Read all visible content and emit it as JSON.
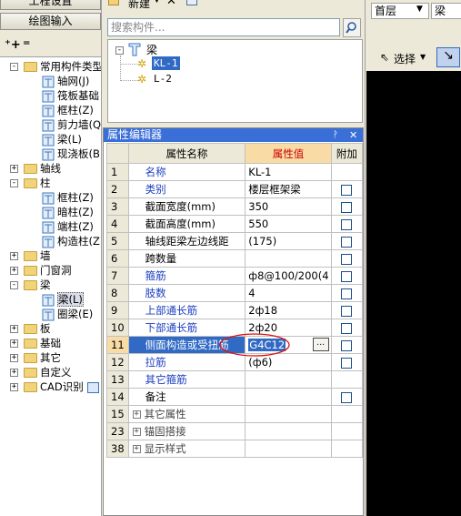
{
  "left_panel": {
    "tab_top": "工程设置",
    "tab_draw": "绘图输入",
    "tree": [
      {
        "label": "常用构件类型",
        "level": 0,
        "state": "-",
        "folder": true
      },
      {
        "label": "轴网(J)",
        "level": 1,
        "icon": "grid-icon"
      },
      {
        "label": "筏板基础",
        "level": 1,
        "icon": "raft-icon"
      },
      {
        "label": "框柱(Z)",
        "level": 1,
        "icon": "column-icon"
      },
      {
        "label": "剪力墙(Q)",
        "level": 1,
        "icon": "wall-icon"
      },
      {
        "label": "梁(L)",
        "level": 1,
        "icon": "beam-icon"
      },
      {
        "label": "现浇板(B)",
        "level": 1,
        "icon": "slab-icon"
      },
      {
        "label": "轴线",
        "level": 0,
        "state": "+",
        "folder": true
      },
      {
        "label": "柱",
        "level": 0,
        "state": "-",
        "folder": true
      },
      {
        "label": "框柱(Z)",
        "level": 1,
        "icon": "column-icon"
      },
      {
        "label": "暗柱(Z)",
        "level": 1,
        "icon": "column-icon"
      },
      {
        "label": "端柱(Z)",
        "level": 1,
        "icon": "column-icon"
      },
      {
        "label": "构造柱(Z)",
        "level": 1,
        "icon": "constr-column-icon"
      },
      {
        "label": "墙",
        "level": 0,
        "state": "+",
        "folder": true
      },
      {
        "label": "门窗洞",
        "level": 0,
        "state": "+",
        "folder": true
      },
      {
        "label": "梁",
        "level": 0,
        "state": "-",
        "folder": true
      },
      {
        "label": "梁(L)",
        "level": 1,
        "icon": "beam-icon",
        "selected": true
      },
      {
        "label": "圈梁(E)",
        "level": 1,
        "icon": "ring-beam-icon"
      },
      {
        "label": "板",
        "level": 0,
        "state": "+",
        "folder": true
      },
      {
        "label": "基础",
        "level": 0,
        "state": "+",
        "folder": true
      },
      {
        "label": "其它",
        "level": 0,
        "state": "+",
        "folder": true
      },
      {
        "label": "自定义",
        "level": 0,
        "state": "+",
        "folder": true
      },
      {
        "label": "CAD识别",
        "level": 0,
        "state": "+",
        "folder": true
      }
    ]
  },
  "toolbar": {
    "new_label": "新建"
  },
  "search": {
    "placeholder": "搜索构件..."
  },
  "component_tree": {
    "root": "梁",
    "items": [
      {
        "label": "KL-1",
        "selected": true
      },
      {
        "label": "L-2",
        "selected": false
      }
    ]
  },
  "property_editor": {
    "title": "属性编辑器",
    "headers": {
      "name": "属性名称",
      "value": "属性值",
      "extra": "附加"
    },
    "rows": [
      {
        "num": "1",
        "name": "名称",
        "value": "KL-1",
        "checkbox": false,
        "style": "k"
      },
      {
        "num": "2",
        "name": "类别",
        "value": "楼层框架梁",
        "checkbox": true,
        "style": "k"
      },
      {
        "num": "3",
        "name": "截面宽度(mm)",
        "value": "350",
        "checkbox": true,
        "style": "b"
      },
      {
        "num": "4",
        "name": "截面高度(mm)",
        "value": "550",
        "checkbox": true,
        "style": "b"
      },
      {
        "num": "5",
        "name": "轴线距梁左边线距",
        "value": "(175)",
        "checkbox": true,
        "style": "b"
      },
      {
        "num": "6",
        "name": "跨数量",
        "value": "",
        "checkbox": true,
        "style": "b"
      },
      {
        "num": "7",
        "name": "箍筋",
        "value": "ф8@100/200(4",
        "checkbox": true,
        "style": "k"
      },
      {
        "num": "8",
        "name": "肢数",
        "value": "4",
        "checkbox": true,
        "style": "k"
      },
      {
        "num": "9",
        "name": "上部通长筋",
        "value": "2ф18",
        "checkbox": true,
        "style": "k"
      },
      {
        "num": "10",
        "name": "下部通长筋",
        "value": "2ф20",
        "checkbox": true,
        "style": "k"
      },
      {
        "num": "11",
        "name": "侧面构造或受扭筋",
        "value": "G4C12",
        "checkbox": true,
        "style": "k",
        "selected": true
      },
      {
        "num": "12",
        "name": "拉筋",
        "value": "(ф6)",
        "checkbox": true,
        "style": "k"
      },
      {
        "num": "13",
        "name": "其它箍筋",
        "value": "",
        "checkbox": false,
        "style": "k"
      },
      {
        "num": "14",
        "name": "备注",
        "value": "",
        "checkbox": true,
        "style": "b"
      },
      {
        "num": "15",
        "name": "其它属性",
        "value": "",
        "checkbox": false,
        "style": "g",
        "group": true
      },
      {
        "num": "23",
        "name": "锚固搭接",
        "value": "",
        "checkbox": false,
        "style": "g",
        "group": true
      },
      {
        "num": "38",
        "name": "显示样式",
        "value": "",
        "checkbox": false,
        "style": "g",
        "group": true
      }
    ],
    "ellipsis": "…"
  },
  "right_panel": {
    "floor_label": "首层",
    "type_label": "梁",
    "select_label": "选择"
  },
  "colors": {
    "title_bar": "#3a6fd8",
    "header_value": "#f9dca5",
    "selected": "#316ac5",
    "annotation": "#d11"
  }
}
